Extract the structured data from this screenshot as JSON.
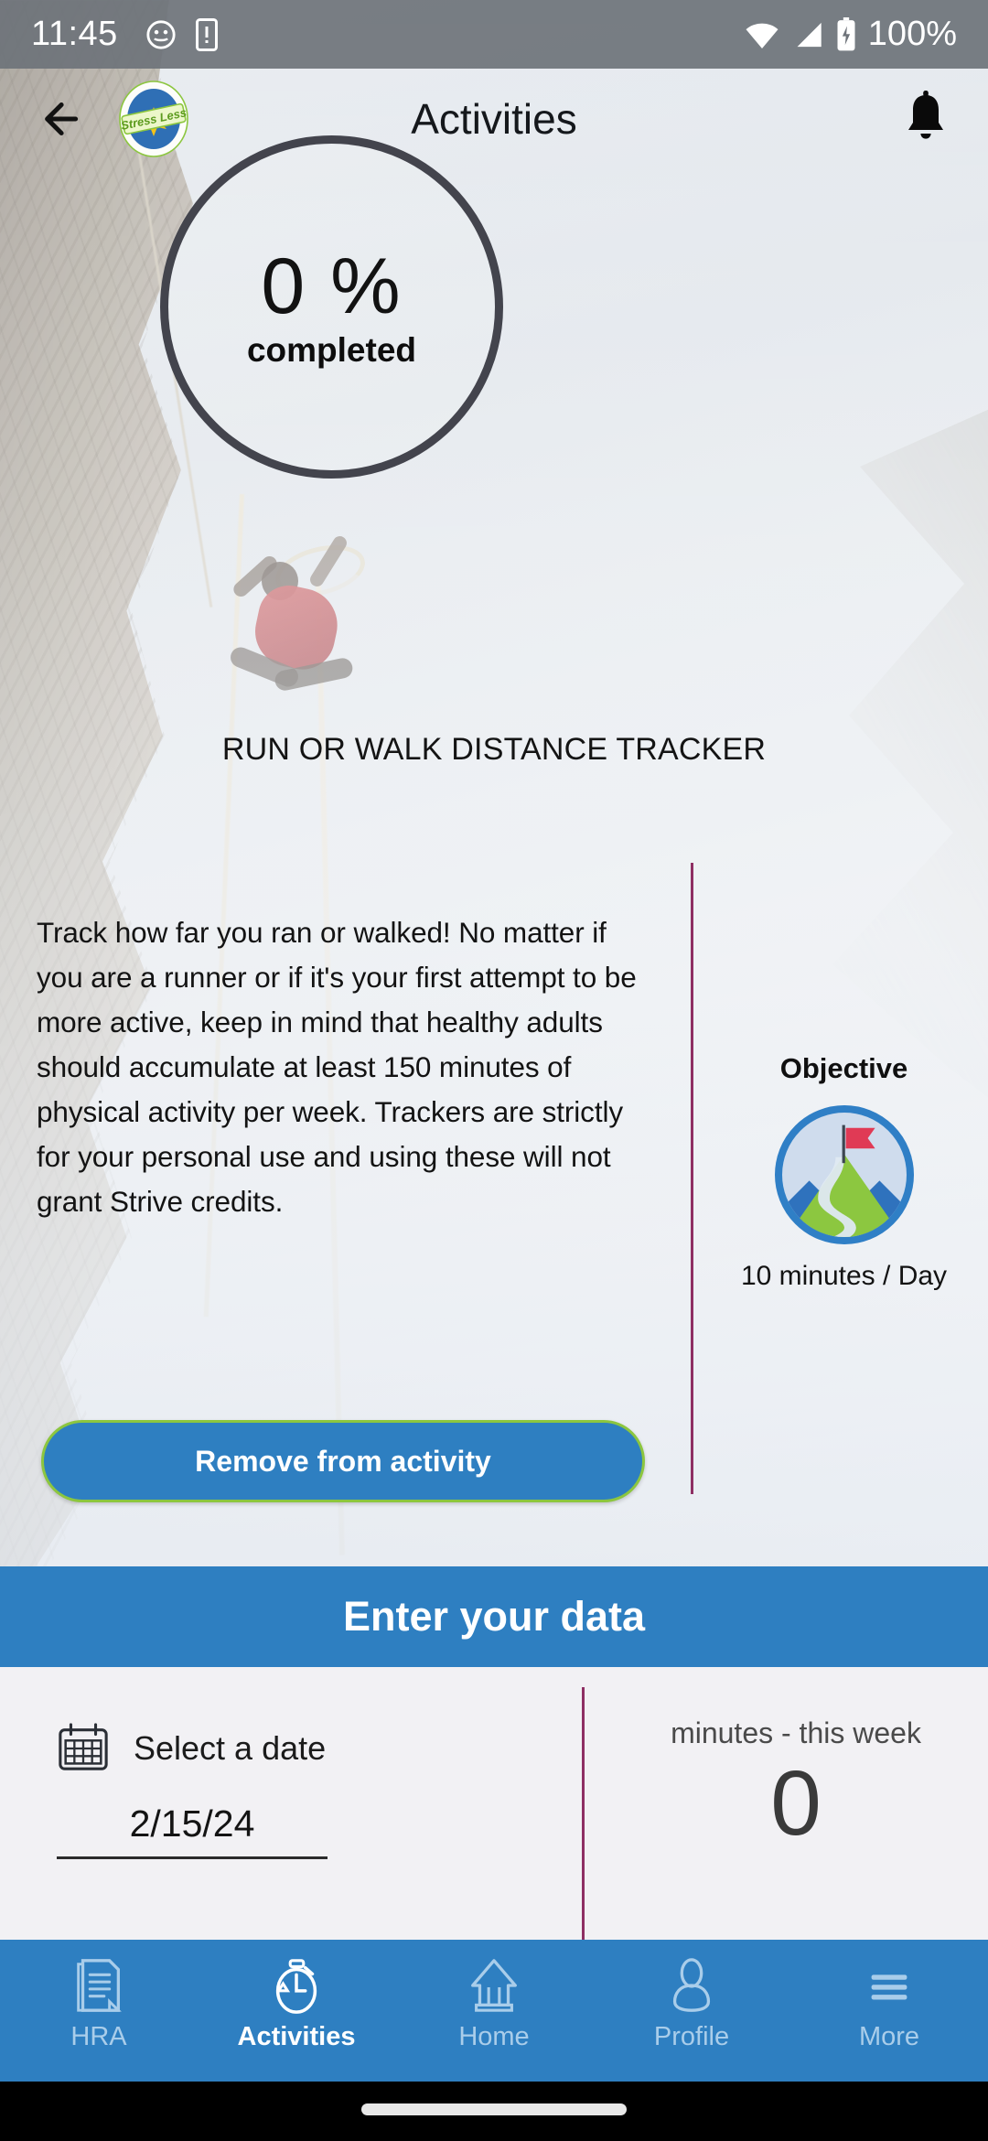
{
  "statusbar": {
    "time": "11:45",
    "battery_text": "100%",
    "icons": [
      "face-icon",
      "sim-card-icon",
      "wifi-icon",
      "signal-icon",
      "battery-charging-icon"
    ]
  },
  "header": {
    "back_icon": "back-arrow-icon",
    "logo_text": "Stress Less",
    "title": "Activities",
    "bell_icon": "notification-bell-icon"
  },
  "progress": {
    "percent": "0 %",
    "caption": "completed",
    "value": 0,
    "ring_color": "#43444d"
  },
  "tracker": {
    "title": "RUN OR WALK DISTANCE TRACKER",
    "description": "Track how far you ran or walked! No matter if you are a runner or if it's your first attempt to be more active, keep in mind that healthy adults should accumulate at least 150 minutes of physical activity per week. Trackers are strictly for your personal use and using these will not grant Strive credits."
  },
  "objective": {
    "title": "Objective",
    "icon": "mountain-flag-goal-icon",
    "value": "10 minutes / Day"
  },
  "actions": {
    "remove_label": "Remove from activity",
    "remove_bg": "#2e7fc1",
    "remove_border": "#8cc63f"
  },
  "enter_data": {
    "header": "Enter your data",
    "date_picker": {
      "icon": "calendar-icon",
      "label": "Select a date",
      "value": "2/15/24"
    },
    "summary": {
      "label": "minutes - this week",
      "value": "0"
    }
  },
  "bottomnav": {
    "items": [
      {
        "label": "HRA",
        "icon": "document-icon",
        "active": false
      },
      {
        "label": "Activities",
        "icon": "stopwatch-icon",
        "active": true
      },
      {
        "label": "Home",
        "icon": "house-icon",
        "active": false
      },
      {
        "label": "Profile",
        "icon": "person-icon",
        "active": false
      },
      {
        "label": "More",
        "icon": "hamburger-icon",
        "active": false
      }
    ],
    "bg": "#2e7fc1",
    "inactive_color": "#a9cdea",
    "active_color": "#ffffff"
  },
  "colors": {
    "accent_blue": "#2e7fc1",
    "accent_green": "#8cc63f",
    "divider_purple": "#8e2f63"
  }
}
